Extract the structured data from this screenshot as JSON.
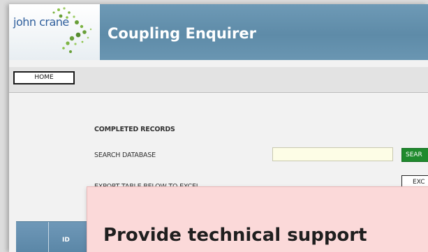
{
  "header": {
    "logo_text": "john crane",
    "title": "Coupling Enquirer"
  },
  "nav": {
    "home_label": "HOME"
  },
  "main": {
    "section_title": "COMPLETED RECORDS",
    "search_label": "SEARCH DATABASE",
    "search_value": "",
    "search_button": "SEAR",
    "export_label": "EXPORT TABLE BELOW TO EXCEL",
    "export_button": "EXC"
  },
  "table": {
    "columns": [
      "ID"
    ]
  },
  "overlay": {
    "text": "Provide technical support"
  },
  "colors": {
    "header_blue": "#6e9ab6",
    "search_button_green": "#1f8a2d",
    "search_input_bg": "#fdfde6",
    "overlay_pink": "#fbd9d9"
  },
  "icons": {
    "logo": "john-crane-logo-dots"
  }
}
